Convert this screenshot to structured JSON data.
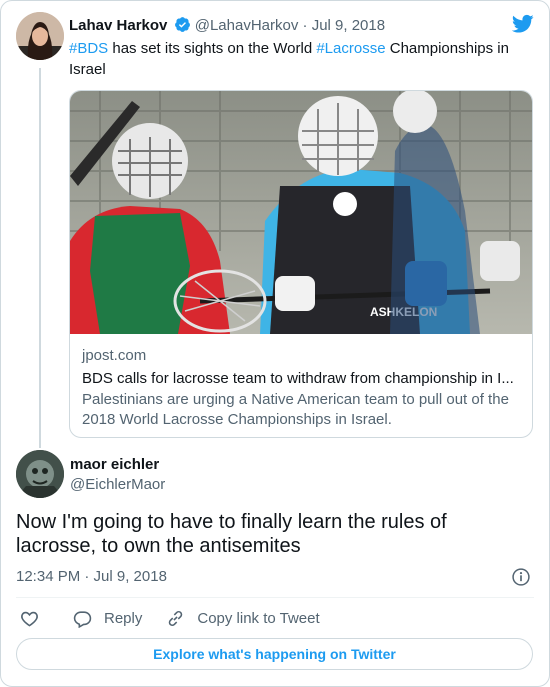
{
  "parent_tweet": {
    "name": "Lahav Harkov",
    "handle": "@LahavHarkov",
    "separator": "·",
    "date": "Jul 9, 2018",
    "text_parts": [
      {
        "text": "#BDS",
        "kind": "hashtag"
      },
      {
        "text": " has set its sights on the World ",
        "kind": "plain"
      },
      {
        "text": "#Lacrosse",
        "kind": "hashtag"
      },
      {
        "text": " Championships in Israel",
        "kind": "plain"
      }
    ],
    "card": {
      "domain": "jpost.com",
      "title": "BDS calls for lacrosse team to withdraw from championship in I...",
      "description": "Palestinians are urging a Native American team to pull out of the 2018 World Lacrosse Championships in Israel."
    }
  },
  "main_tweet": {
    "name": "maor eichler",
    "handle": "@EichlerMaor",
    "text": "Now I'm going to have to finally learn the rules of lacrosse, to own the antisemites",
    "time": "12:34 PM · Jul 9, 2018"
  },
  "actions": {
    "reply_label": "Reply",
    "copy_link_label": "Copy link to Tweet"
  },
  "explore_label": "Explore what's happening on Twitter",
  "colors": {
    "accent": "#1d9bf0",
    "secondary_text": "#536471",
    "border": "#cfd9de"
  },
  "icons": [
    "verified-badge-icon",
    "twitter-bird-icon",
    "info-icon",
    "heart-icon",
    "reply-icon",
    "link-icon"
  ]
}
